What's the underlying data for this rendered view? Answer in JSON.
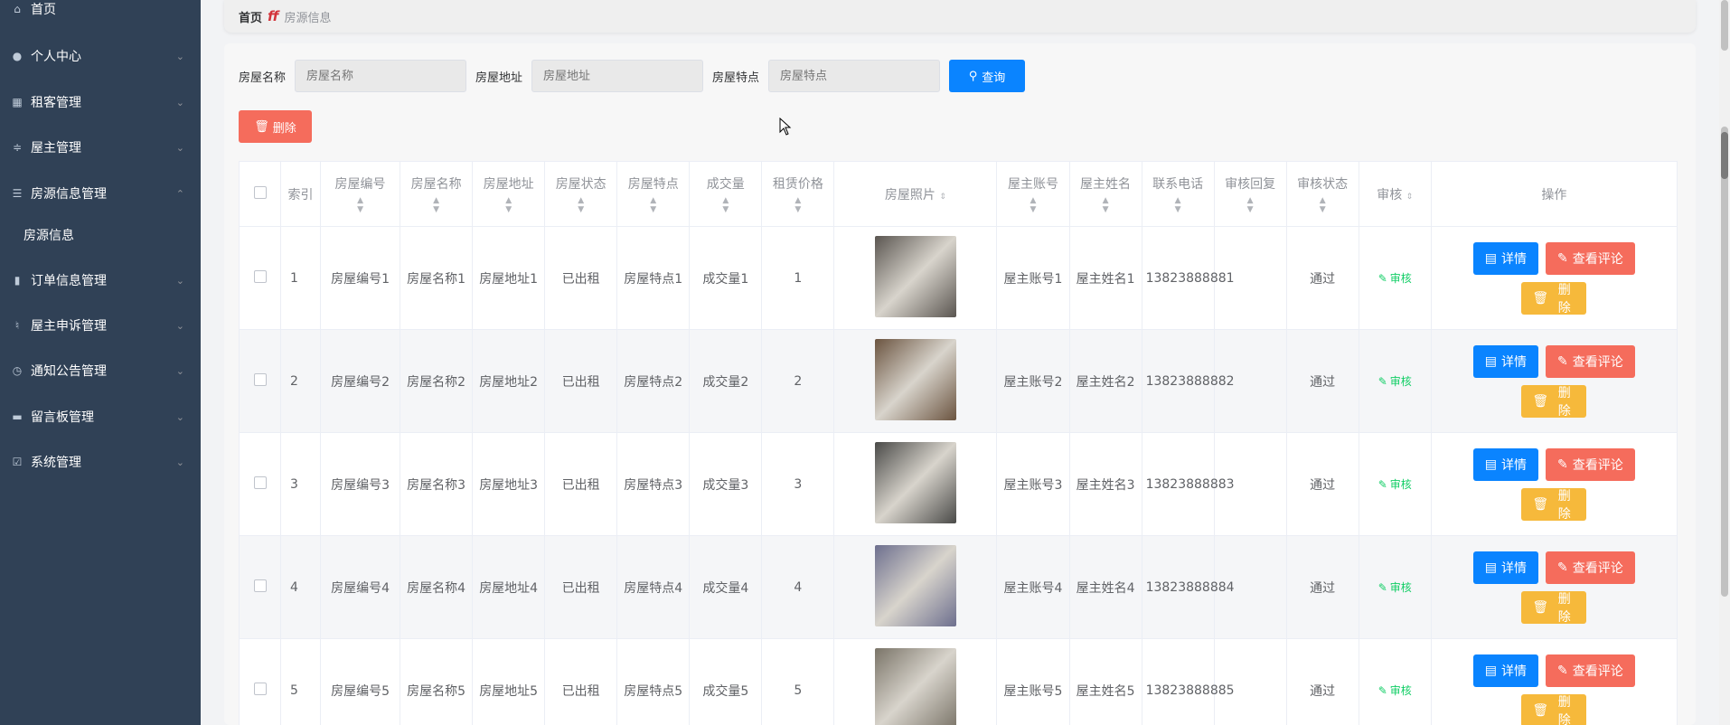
{
  "sidebar": {
    "items": [
      {
        "label": "首页",
        "icon": "home-icon"
      },
      {
        "label": "个人中心",
        "icon": "user-icon"
      },
      {
        "label": "租客管理",
        "icon": "grid-icon"
      },
      {
        "label": "屋主管理",
        "icon": "sliders-icon"
      },
      {
        "label": "房源信息管理",
        "icon": "list-icon"
      },
      {
        "label": "订单信息管理",
        "icon": "chart-icon"
      },
      {
        "label": "屋主申诉管理",
        "icon": "mic-icon"
      },
      {
        "label": "通知公告管理",
        "icon": "clock-icon"
      },
      {
        "label": "留言板管理",
        "icon": "board-icon"
      },
      {
        "label": "系统管理",
        "icon": "check-icon"
      }
    ],
    "sub_items": [
      {
        "label": "房源信息"
      }
    ]
  },
  "breadcrumb": {
    "home": "首页",
    "current": "房源信息"
  },
  "search": {
    "name_label": "房屋名称",
    "name_placeholder": "房屋名称",
    "address_label": "房屋地址",
    "address_placeholder": "房屋地址",
    "feature_label": "房屋特点",
    "feature_placeholder": "房屋特点",
    "query_label": "查询"
  },
  "toolbar": {
    "delete_label": "删除"
  },
  "table": {
    "headers": {
      "index": "索引",
      "code": "房屋编号",
      "name": "房屋名称",
      "address": "房屋地址",
      "status": "房屋状态",
      "feature": "房屋特点",
      "deals": "成交量",
      "price": "租赁价格",
      "photo": "房屋照片",
      "owner_account": "屋主账号",
      "owner_name": "屋主姓名",
      "phone": "联系电话",
      "audit_reply": "审核回复",
      "audit_status": "审核状态",
      "audit": "审核",
      "ops": "操作"
    },
    "rows": [
      {
        "index": "1",
        "code": "房屋编号1",
        "name": "房屋名称1",
        "address": "房屋地址1",
        "status": "已出租",
        "feature": "房屋特点1",
        "deals": "成交量1",
        "price": "1",
        "owner_account": "屋主账号1",
        "owner_name": "屋主姓名1",
        "phone": "13823888881",
        "audit_reply": "",
        "audit_status": "通过",
        "audit": "审核",
        "photo_color": "#5a5550"
      },
      {
        "index": "2",
        "code": "房屋编号2",
        "name": "房屋名称2",
        "address": "房屋地址2",
        "status": "已出租",
        "feature": "房屋特点2",
        "deals": "成交量2",
        "price": "2",
        "owner_account": "屋主账号2",
        "owner_name": "屋主姓名2",
        "phone": "13823888882",
        "audit_reply": "",
        "audit_status": "通过",
        "audit": "审核",
        "photo_color": "#6b5440"
      },
      {
        "index": "3",
        "code": "房屋编号3",
        "name": "房屋名称3",
        "address": "房屋地址3",
        "status": "已出租",
        "feature": "房屋特点3",
        "deals": "成交量3",
        "price": "3",
        "owner_account": "屋主账号3",
        "owner_name": "屋主姓名3",
        "phone": "13823888883",
        "audit_reply": "",
        "audit_status": "通过",
        "audit": "审核",
        "photo_color": "#4a4a48"
      },
      {
        "index": "4",
        "code": "房屋编号4",
        "name": "房屋名称4",
        "address": "房屋地址4",
        "status": "已出租",
        "feature": "房屋特点4",
        "deals": "成交量4",
        "price": "4",
        "owner_account": "屋主账号4",
        "owner_name": "屋主姓名4",
        "phone": "13823888884",
        "audit_reply": "",
        "audit_status": "通过",
        "audit": "审核",
        "photo_color": "#6d6f8e"
      },
      {
        "index": "5",
        "code": "房屋编号5",
        "name": "房屋名称5",
        "address": "房屋地址5",
        "status": "已出租",
        "feature": "房屋特点5",
        "deals": "成交量5",
        "price": "5",
        "owner_account": "屋主账号5",
        "owner_name": "屋主姓名5",
        "phone": "13823888885",
        "audit_reply": "",
        "audit_status": "通过",
        "audit": "审核",
        "photo_color": "#7a7468"
      }
    ],
    "row_actions": {
      "detail": "详情",
      "comments": "查看评论",
      "delete": "删除"
    }
  },
  "colors": {
    "sidebar_bg": "#304156",
    "primary": "#0a84ff",
    "danger": "#f56c5c",
    "warning": "#f6b93b",
    "success": "#13ce66"
  }
}
